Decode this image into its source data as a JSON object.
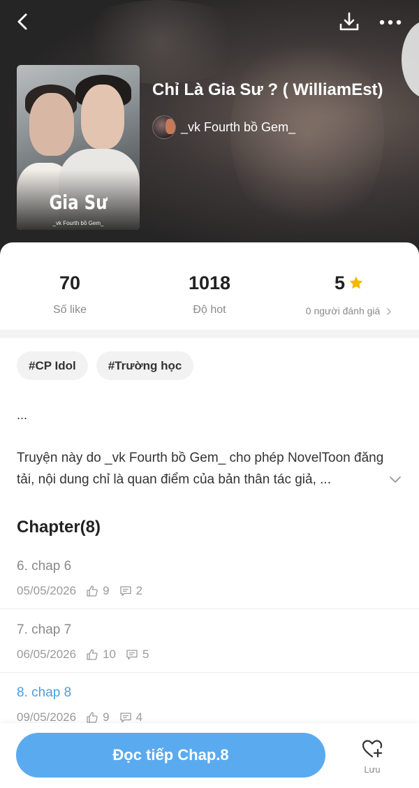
{
  "header": {
    "book_title": "Chỉ Là Gia Sư ? ( WilliamEst)",
    "author": "_vk Fourth bồ Gem_",
    "cover_title": "Gia Sư",
    "cover_author": "_vk Fourth bồ Gem_"
  },
  "stats": {
    "likes_value": "70",
    "likes_label": "Số like",
    "hot_value": "1018",
    "hot_label": "Độ hot",
    "rating_value": "5",
    "rating_label": "0 người đánh giá"
  },
  "tags": [
    "#CP Idol",
    "#Trường học"
  ],
  "description": {
    "ellipsis": "...",
    "text": "Truyện này do _vk Fourth bồ Gem_ cho phép NovelToon đăng tải, nội dung chỉ là quan điểm của bản thân tác giả, ..."
  },
  "chapters": {
    "header": "Chapter(8)",
    "items": [
      {
        "title": "6. chap 6",
        "date": "05/05/2026",
        "likes": "9",
        "comments": "2"
      },
      {
        "title": "7. chap 7",
        "date": "06/05/2026",
        "likes": "10",
        "comments": "5"
      },
      {
        "title": "8. chap 8",
        "date": "09/05/2026",
        "likes": "9",
        "comments": "4"
      }
    ]
  },
  "actions": {
    "read_label": "Đọc tiếp Chap.8",
    "save_label": "Lưu"
  },
  "colors": {
    "accent": "#5aaaf0",
    "current_chapter": "#4a9fe0",
    "star": "#f5b800"
  },
  "icons": [
    "back-icon",
    "download-icon",
    "more-icon",
    "star-icon",
    "chevron-right-icon",
    "chevron-down-icon",
    "thumb-up-icon",
    "comment-icon",
    "heart-plus-icon"
  ]
}
